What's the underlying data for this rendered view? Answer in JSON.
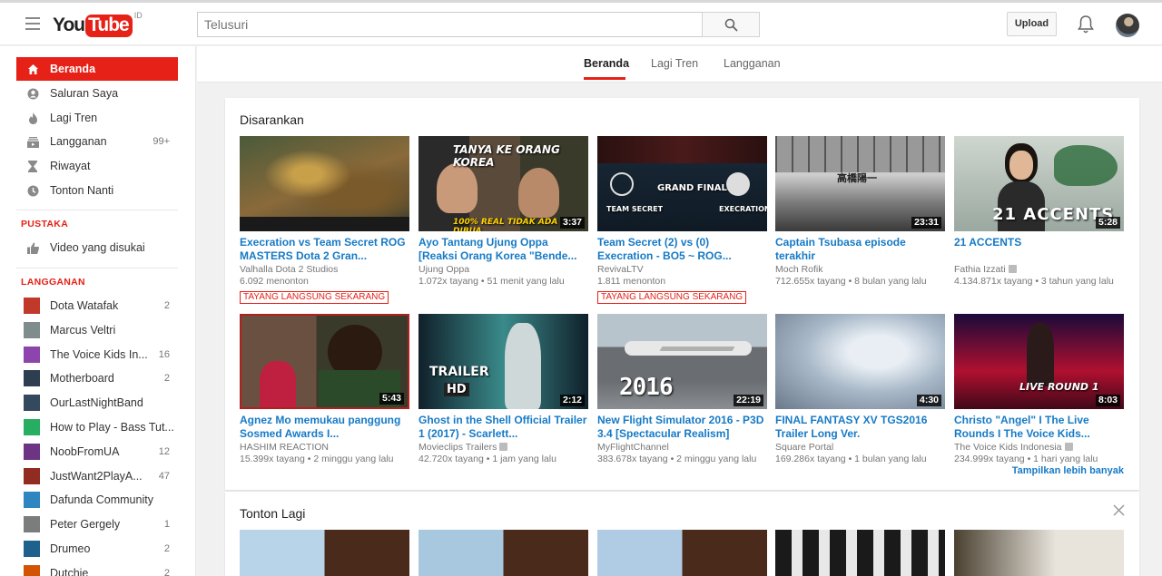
{
  "header": {
    "logo_you": "You",
    "logo_tube": "Tube",
    "region": "ID",
    "search_placeholder": "Telusuri",
    "upload_label": "Upload"
  },
  "sidebar": {
    "main": [
      {
        "label": "Beranda",
        "icon": "home-icon"
      },
      {
        "label": "Saluran Saya",
        "icon": "person-icon"
      },
      {
        "label": "Lagi Tren",
        "icon": "flame-icon"
      },
      {
        "label": "Langganan",
        "icon": "subscriptions-icon",
        "count": "99+"
      },
      {
        "label": "Riwayat",
        "icon": "hourglass-icon"
      },
      {
        "label": "Tonton Nanti",
        "icon": "clock-icon"
      }
    ],
    "library_heading": "PUSTAKA",
    "library": [
      {
        "label": "Video yang disukai",
        "icon": "thumbs-up-icon"
      }
    ],
    "subs_heading": "LANGGANAN",
    "subscriptions": [
      {
        "label": "Dota Watafak",
        "count": "2"
      },
      {
        "label": "Marcus Veltri",
        "count": ""
      },
      {
        "label": "The Voice Kids In...",
        "count": "16"
      },
      {
        "label": "Motherboard",
        "count": "2"
      },
      {
        "label": "OurLastNightBand",
        "count": ""
      },
      {
        "label": "How to Play - Bass Tut...",
        "count": ""
      },
      {
        "label": "NoobFromUA",
        "count": "12"
      },
      {
        "label": "JustWant2PlayA...",
        "count": "47"
      },
      {
        "label": "Dafunda Community",
        "count": ""
      },
      {
        "label": "Peter Gergely",
        "count": "1"
      },
      {
        "label": "Drumeo",
        "count": "2"
      },
      {
        "label": "Dutchie",
        "count": "2"
      }
    ]
  },
  "tabs": [
    "Beranda",
    "Lagi Tren",
    "Langganan"
  ],
  "recommended": {
    "title": "Disarankan",
    "more_label": "Tampilkan lebih banyak",
    "videos": [
      {
        "title": "Execration vs Team Secret ROG MASTERS Dota 2 Gran...",
        "channel": "Valhalla Dota 2 Studios",
        "meta": "6.092 menonton",
        "live": "TAYANG LANGSUNG SEKARANG",
        "duration": ""
      },
      {
        "title": "Ayo Tantang Ujung Oppa [Reaksi Orang Korea \"Bende...",
        "channel": "Ujung Oppa",
        "meta": "1.072x tayang • 51 menit yang lalu",
        "live": "",
        "duration": "3:37",
        "overlay": "TANYA KE ORANG KOREA",
        "overlay2": "100% REAL TIDAK ADA DIBUA"
      },
      {
        "title": "Team Secret (2) vs (0) Execration - BO5 ~ ROG...",
        "channel": "RevivaLTV",
        "meta": "1.811 menonton",
        "live": "TAYANG LANGSUNG SEKARANG",
        "duration": "",
        "overlay": "GRAND FINAL",
        "overlay2": "TEAM SECRET",
        "overlay3": "EXECRATION"
      },
      {
        "title": "Captain Tsubasa episode terakhir",
        "channel": "Moch Rofik",
        "meta": "712.655x tayang • 8 bulan yang lalu",
        "live": "",
        "duration": "23:31",
        "overlay": "高橋陽一"
      },
      {
        "title": "21 ACCENTS",
        "channel": "Fathia Izzati",
        "meta": "4.134.871x tayang • 3 tahun yang lalu",
        "live": "",
        "duration": "5:28",
        "overlay": "21 ACCENTS"
      },
      {
        "title": "Agnez Mo memukau panggung Sosmed Awards I...",
        "channel": "HASHIM REACTION",
        "meta": "15.399x tayang • 2 minggu yang lalu",
        "live": "",
        "duration": "5:43"
      },
      {
        "title": "Ghost in the Shell Official Trailer 1 (2017) - Scarlett...",
        "channel": "Movieclips Trailers",
        "meta": "42.720x tayang • 1 jam yang lalu",
        "live": "",
        "duration": "2:12",
        "overlay": "TRAILER",
        "overlay2": "HD"
      },
      {
        "title": "New Flight Simulator 2016 - P3D 3.4 [Spectacular Realism]",
        "channel": "MyFlightChannel",
        "meta": "383.678x tayang • 2 minggu yang lalu",
        "live": "",
        "duration": "22:19",
        "overlay": "2016"
      },
      {
        "title": "FINAL FANTASY XV TGS2016 Trailer Long Ver.",
        "channel": "Square Portal",
        "meta": "169.286x tayang • 1 bulan yang lalu",
        "live": "",
        "duration": "4:30"
      },
      {
        "title": "Christo \"Angel\" I The Live Rounds I The Voice Kids...",
        "channel": "The Voice Kids Indonesia",
        "meta": "234.999x tayang • 1 hari yang lalu",
        "live": "",
        "duration": "8:03",
        "overlay": "LIVE ROUND 1"
      }
    ]
  },
  "watch_again": {
    "title": "Tonton Lagi"
  }
}
